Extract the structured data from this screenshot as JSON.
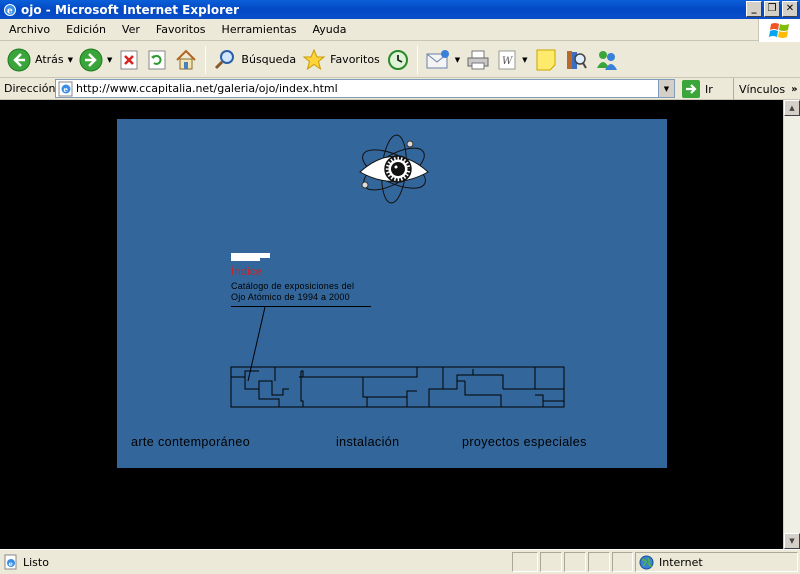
{
  "window": {
    "title": "ojo - Microsoft Internet Explorer"
  },
  "menu": [
    "Archivo",
    "Edición",
    "Ver",
    "Favoritos",
    "Herramientas",
    "Ayuda"
  ],
  "toolbar": {
    "back_label": "Atrás",
    "search_label": "Búsqueda",
    "favorites_label": "Favoritos"
  },
  "address": {
    "label": "Dirección",
    "url": "http://www.ccapitalia.net/galeria/ojo/index.html",
    "go_label": "Ir",
    "links_label": "Vínculos"
  },
  "page": {
    "background": "#000000",
    "panel_color": "#33679b",
    "index_title": "Índice",
    "catalog_line1": "Catálogo de exposiciones del",
    "catalog_line2": "Ojo Atómico de 1994 a 2000",
    "nav": [
      "arte contemporáneo",
      "instalación",
      "proyectos especiales"
    ]
  },
  "status": {
    "text": "Listo",
    "zone": "Internet"
  }
}
